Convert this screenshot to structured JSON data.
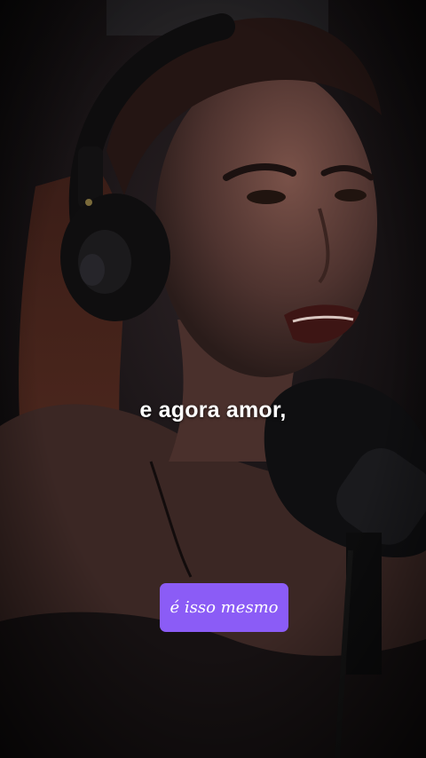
{
  "video": {
    "subtitle": "e agora amor,",
    "watermark_label": "é isso mesmo"
  },
  "colors": {
    "badge_background": "#8b5cf6",
    "subtitle_text": "#ffffff"
  },
  "icons": [
    "headphones-icon",
    "microphone-icon"
  ]
}
